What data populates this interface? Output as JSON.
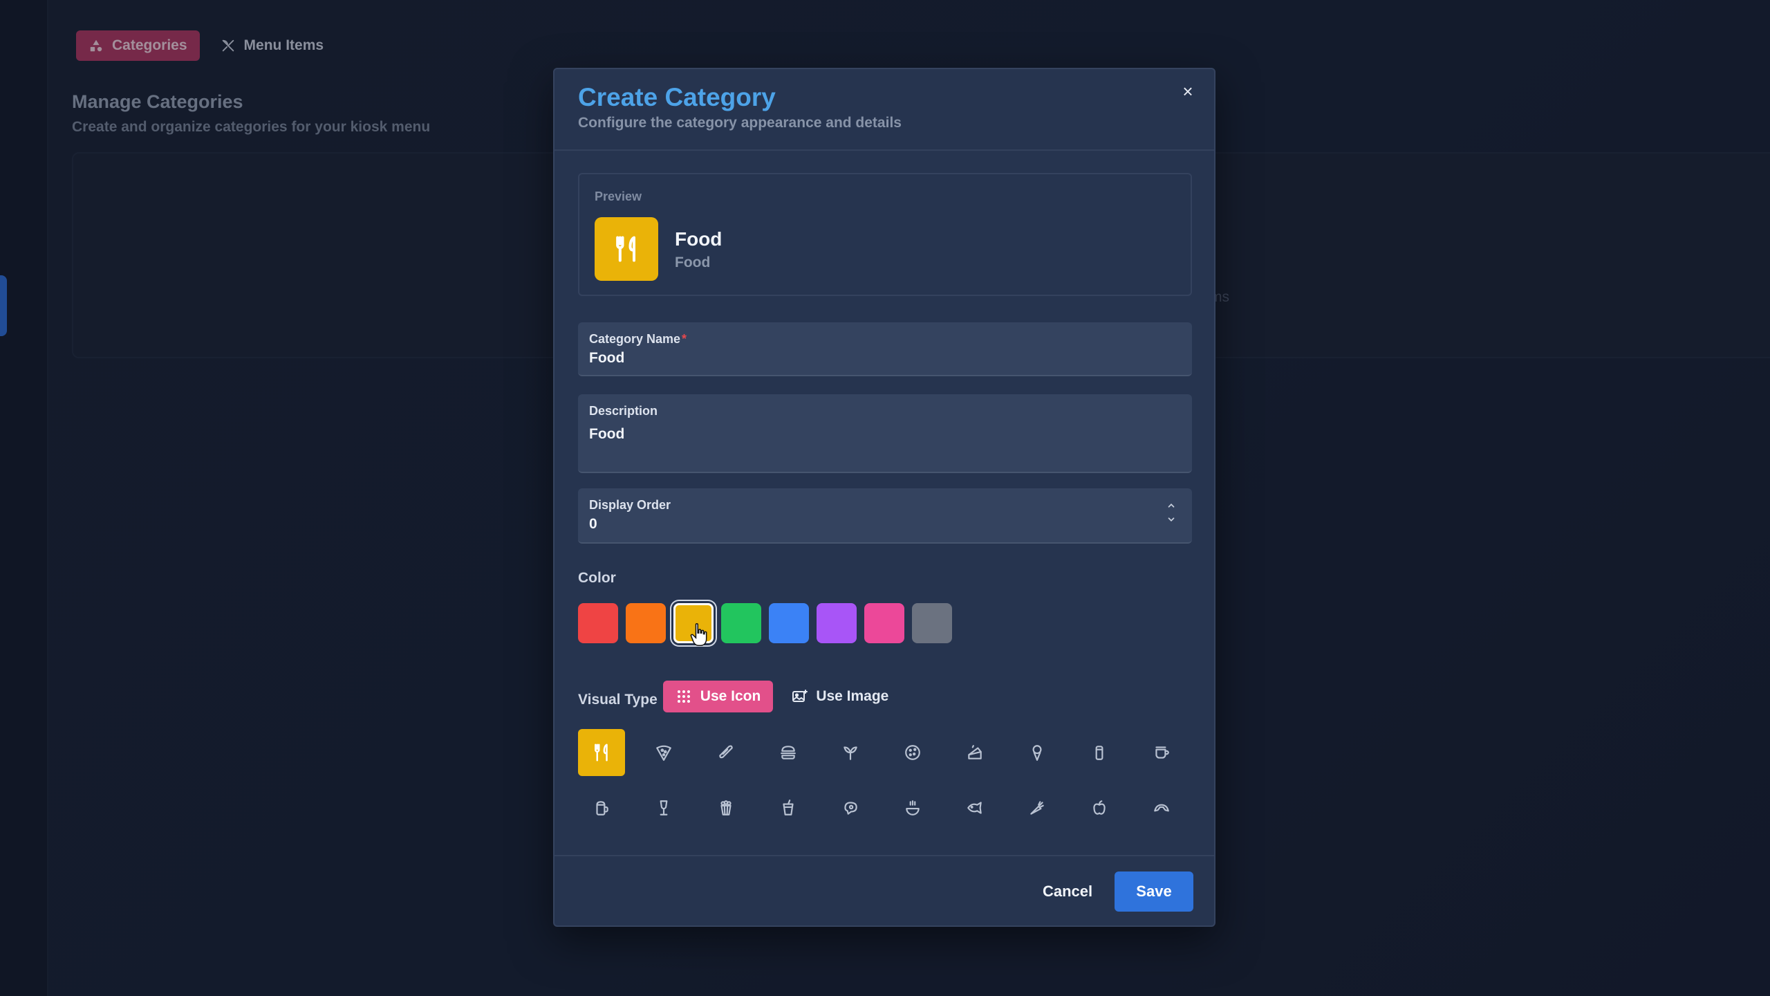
{
  "app": {
    "tabs": [
      {
        "label": "Categories",
        "icon": "shapes-icon",
        "active": true
      },
      {
        "label": "Menu Items",
        "icon": "utensils-crossed-icon",
        "active": false
      }
    ],
    "page_title": "Manage Categories",
    "page_subtitle": "Create and organize categories for your kiosk menu",
    "card_partial_text": "ms"
  },
  "modal": {
    "title": "Create Category",
    "subtitle": "Configure the category appearance and details",
    "close_label": "×",
    "preview": {
      "label": "Preview",
      "name": "Food",
      "description": "Food",
      "icon": "utensils-icon",
      "color": "#eab308"
    },
    "fields": {
      "name": {
        "label": "Category Name",
        "required_mark": "*",
        "value": "Food"
      },
      "description": {
        "label": "Description",
        "value": "Food"
      },
      "display_order": {
        "label": "Display Order",
        "value": "0"
      }
    },
    "color": {
      "label": "Color",
      "selected_index": 2,
      "options": [
        "#ef4444",
        "#f97316",
        "#eab308",
        "#22c55e",
        "#3b82f6",
        "#a855f7",
        "#ec4899",
        "#6b7280"
      ]
    },
    "visual_type": {
      "label": "Visual Type",
      "options": [
        {
          "label": "Use Icon",
          "icon": "grid-icon",
          "active": true
        },
        {
          "label": "Use Image",
          "icon": "image-icon",
          "active": false
        }
      ]
    },
    "icons": {
      "selected_index": 0,
      "items": [
        "utensils-icon",
        "pizza-icon",
        "sandwich-icon",
        "burger-icon",
        "salad-icon",
        "cookie-icon",
        "cake-icon",
        "ice-cream-icon",
        "drink-can-icon",
        "coffee-icon",
        "beer-icon",
        "wine-icon",
        "popcorn-icon",
        "soda-cup-icon",
        "beef-icon",
        "soup-icon",
        "fish-icon",
        "carrot-icon",
        "apple-icon",
        "croissant-icon"
      ]
    },
    "footer": {
      "cancel_label": "Cancel",
      "save_label": "Save"
    }
  }
}
